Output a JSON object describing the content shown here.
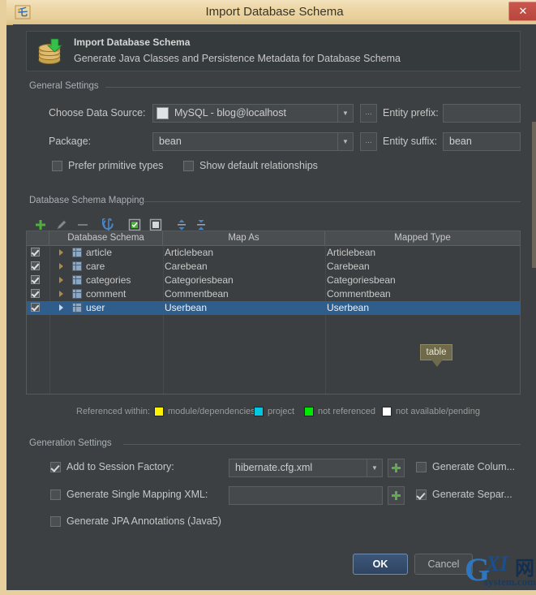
{
  "window": {
    "title": "Import Database Schema",
    "app_icon": "intellij-icon",
    "close_label": "✕"
  },
  "banner": {
    "icon": "database-import-icon",
    "title": "Import Database Schema",
    "subtitle": "Generate Java Classes and Persistence Metadata for Database Schema"
  },
  "general_settings": {
    "group_title": "General Settings",
    "data_source_label": "Choose Data Source:",
    "data_source_value": "MySQL - blog@localhost",
    "data_source_icon": "mysql-icon",
    "browse_label": "...",
    "entity_prefix_label": "Entity prefix:",
    "entity_prefix_value": "",
    "package_label": "Package:",
    "package_value": "bean",
    "entity_suffix_label": "Entity suffix:",
    "entity_suffix_value": "bean",
    "prefer_primitive_types_label": "Prefer primitive types",
    "prefer_primitive_types_checked": false,
    "show_default_relationships_label": "Show default relationships",
    "show_default_relationships_checked": false
  },
  "mapping": {
    "group_title": "Database Schema Mapping",
    "toolbar": [
      {
        "name": "add-icon",
        "glyph": "+"
      },
      {
        "name": "edit-pencil-icon",
        "glyph": "✎"
      },
      {
        "name": "remove-icon",
        "glyph": "−"
      },
      {
        "name": "refresh-sync-icon",
        "glyph": "↻"
      },
      {
        "name": "select-all-icon",
        "glyph": "☑"
      },
      {
        "name": "deselect-all-icon",
        "glyph": "☐"
      },
      {
        "name": "expand-all-icon",
        "glyph": "⇳"
      },
      {
        "name": "collapse-all-icon",
        "glyph": "⇵"
      }
    ],
    "columns": [
      "Database Schema",
      "Map As",
      "Mapped Type"
    ],
    "rows": [
      {
        "checked": true,
        "schema": "article",
        "map_as": "Articlebean",
        "mapped_type": "Articlebean",
        "selected": false
      },
      {
        "checked": true,
        "schema": "care",
        "map_as": "Carebean",
        "mapped_type": "Carebean",
        "selected": false
      },
      {
        "checked": true,
        "schema": "categories",
        "map_as": "Categoriesbean",
        "mapped_type": "Categoriesbean",
        "selected": false
      },
      {
        "checked": true,
        "schema": "comment",
        "map_as": "Commentbean",
        "mapped_type": "Commentbean",
        "selected": false
      },
      {
        "checked": true,
        "schema": "user",
        "map_as": "Userbean",
        "mapped_type": "Userbean",
        "selected": true
      }
    ],
    "tooltip": "table",
    "legend": {
      "prefix": "Referenced within:",
      "items": [
        {
          "label": "module/dependencies",
          "color": "#fff200"
        },
        {
          "label": "project",
          "color": "#00c8e0"
        },
        {
          "label": "not referenced",
          "color": "#00e800"
        },
        {
          "label": "not available/pending",
          "color": "#ffffff"
        }
      ]
    }
  },
  "generation_settings": {
    "group_title": "Generation Settings",
    "add_to_session_factory_label": "Add to Session Factory:",
    "add_to_session_factory_checked": true,
    "session_factory_value": "hibernate.cfg.xml",
    "generate_columns_label": "Generate Colum...",
    "generate_columns_checked": false,
    "generate_single_mapping_xml_label": "Generate Single Mapping XML:",
    "generate_single_mapping_xml_checked": false,
    "single_mapping_value": "",
    "generate_separate_label": "Generate Separ...",
    "generate_separate_checked": true,
    "generate_jpa_annotations_label": "Generate JPA Annotations (Java5)",
    "generate_jpa_annotations_checked": false
  },
  "footer": {
    "ok_label": "OK",
    "cancel_label": "Cancel"
  },
  "watermark": {
    "g": "G",
    "xi": "XI",
    "cn": "网",
    "sys": "system.com"
  }
}
